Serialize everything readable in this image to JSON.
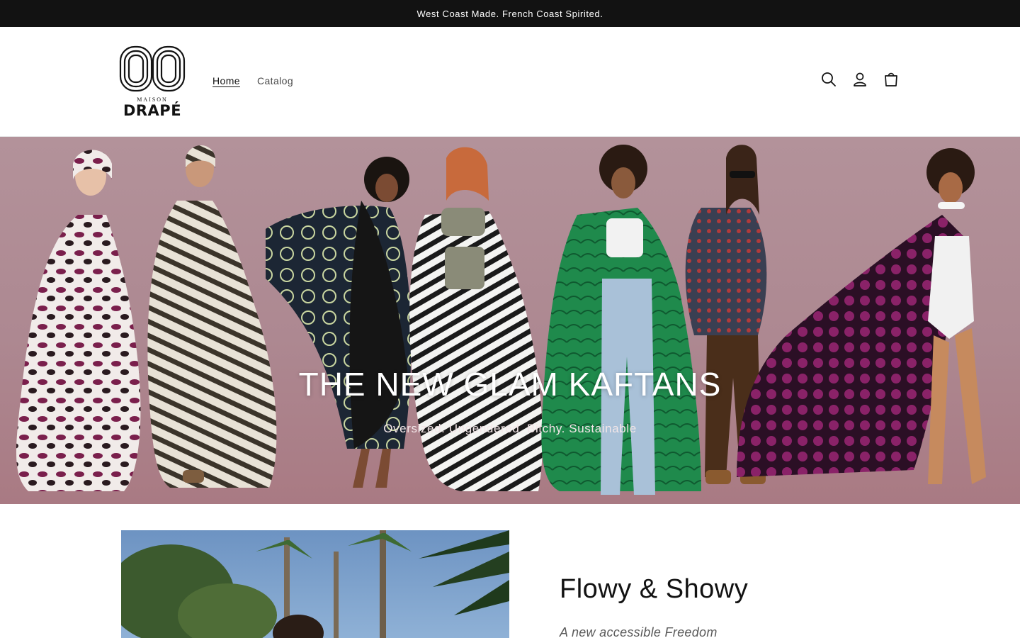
{
  "announcement": {
    "text": "West Coast Made. French Coast Spirited."
  },
  "brand": {
    "small": "MAISON",
    "name": "DRAPÉ"
  },
  "nav": {
    "items": [
      {
        "label": "Home"
      },
      {
        "label": "Catalog"
      }
    ]
  },
  "header_icons": [
    "search-icon",
    "account-icon",
    "cart-icon"
  ],
  "hero": {
    "title": "THE NEW GLAM KAFTANS",
    "subtitle": "Oversized. Ungendered. Bitchy. Sustainable",
    "background_color": "#ad8891"
  },
  "feature": {
    "title": "Flowy & Showy",
    "subtitle": "A new accessible Freedom"
  },
  "colors": {
    "announcement_bg": "#121212",
    "text": "#121212"
  }
}
